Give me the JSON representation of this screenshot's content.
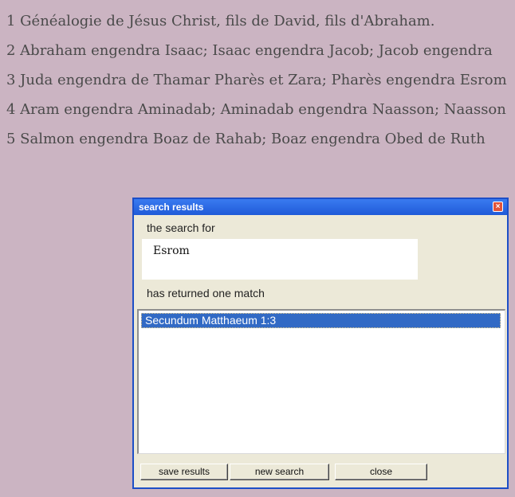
{
  "verses": [
    "1 Généalogie de Jésus Christ, fils de David, fils d'Abraham.",
    "2 Abraham engendra Isaac; Isaac engendra Jacob; Jacob engendra",
    "3 Juda engendra de Thamar Pharès et Zara; Pharès engendra Esrom",
    "4 Aram engendra Aminadab; Aminadab engendra Naasson; Naasson",
    "5 Salmon engendra Boaz de Rahab; Boaz engendra Obed de Ruth"
  ],
  "dialog": {
    "title": "search results",
    "close_glyph": "×",
    "search_for_label": "the search for",
    "search_term": "Esrom",
    "returned_label": "has returned one match",
    "results": [
      "Secundum Matthaeum 1:3"
    ],
    "buttons": {
      "save": "save results",
      "new_search": "new search",
      "close": "close"
    }
  },
  "colors": {
    "background": "#cbb4c2",
    "titlebar": "#1f5ad8",
    "selection": "#316ac5"
  }
}
